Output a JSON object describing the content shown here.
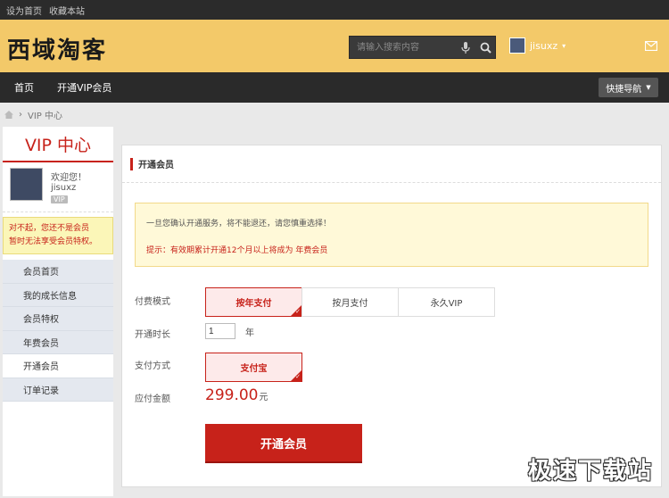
{
  "topbar": {
    "set_home": "设为首页",
    "bookmark": "收藏本站"
  },
  "header": {
    "logo": "西域淘客",
    "search_placeholder": "请输入搜索内容",
    "username": "jisuxz"
  },
  "nav": {
    "items": [
      "首页",
      "开通VIP会员"
    ],
    "quick_nav": "快捷导航"
  },
  "breadcrumb": {
    "current": "VIP 中心"
  },
  "sidebar": {
    "title": "VIP 中心",
    "welcome": "欢迎您！",
    "username": "jisuxz",
    "vip_badge": "VIP",
    "notice_line1": "对不起，您还不是会员",
    "notice_line2": "暂时无法享受会员特权。",
    "menu": [
      "会员首页",
      "我的成长信息",
      "会员特权",
      "年费会员",
      "开通会员",
      "订单记录"
    ]
  },
  "main": {
    "title": "开通会员",
    "tip_line1": "一旦您确认开通服务，将不能退还，请您慎重选择！",
    "tip_line2": "提示：有效期累计开通12个月以上将成为 年费会员",
    "pay_mode_label": "付费模式",
    "pay_modes": [
      "按年支付",
      "按月支付",
      "永久VIP"
    ],
    "duration_label": "开通时长",
    "duration_value": "1",
    "duration_unit": "年",
    "method_label": "支付方式",
    "method_option": "支付宝",
    "amount_label": "应付金额",
    "amount_value": "299.00",
    "amount_unit": "元",
    "submit": "开通会员"
  },
  "watermark": "极速下载站",
  "colors": {
    "header_bg": "#f3c969",
    "accent_red": "#c7221a",
    "nav_bg": "#2a2a2a"
  }
}
